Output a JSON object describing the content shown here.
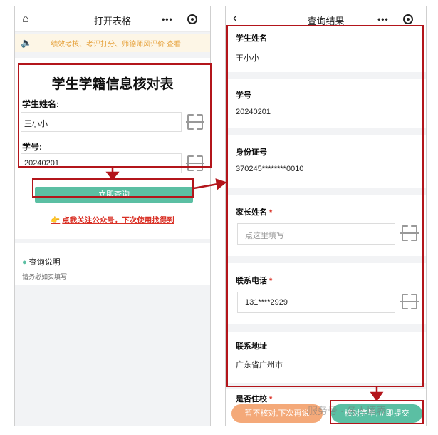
{
  "left": {
    "title": "打开表格",
    "notice": "绩效考核、考评打分、师德师风评价 查看",
    "form_title": "学生学籍信息核对表",
    "fields": [
      {
        "label": "学生姓名:",
        "value": "王小小"
      },
      {
        "label": "学号:",
        "value": "20240201"
      }
    ],
    "query_button": "立即查询",
    "follow_link": "点我关注公众号，下次使用找得到",
    "explain": {
      "title": "查询说明",
      "text": "请务必如实填写"
    }
  },
  "right": {
    "title": "查询结果",
    "fields": [
      {
        "label": "学生姓名",
        "value": "王小小"
      },
      {
        "label": "学号",
        "value": "20240201"
      },
      {
        "label": "身份证号",
        "value": "370245********0010"
      },
      {
        "label": "家长姓名",
        "required": "*",
        "placeholder": "点这里填写"
      },
      {
        "label": "联系电话",
        "required": "*",
        "value": "131****2929"
      },
      {
        "label": "联系地址",
        "value": "广东省广州市"
      },
      {
        "label": "是否住校",
        "required": "*"
      }
    ],
    "buttons": {
      "left": "暂不核对,下次再说",
      "right": "核对完毕,立即提交"
    }
  },
  "watermark": "服务号 · 各人填表",
  "icons": {
    "home": "home-icon",
    "back": "back-chevron-icon",
    "menu": "more-dots-icon",
    "close": "capsule-close-icon",
    "speaker": "speaker-icon",
    "scan": "scan-icon",
    "hand": "pointing-hand-icon",
    "bulb": "lightbulb-icon"
  },
  "colors": {
    "accent_green": "#5bbfa3",
    "highlight_red": "#b3151b",
    "notice_orange": "#e6a23c",
    "button_orange": "#f4a979",
    "link_red": "#d93025"
  }
}
